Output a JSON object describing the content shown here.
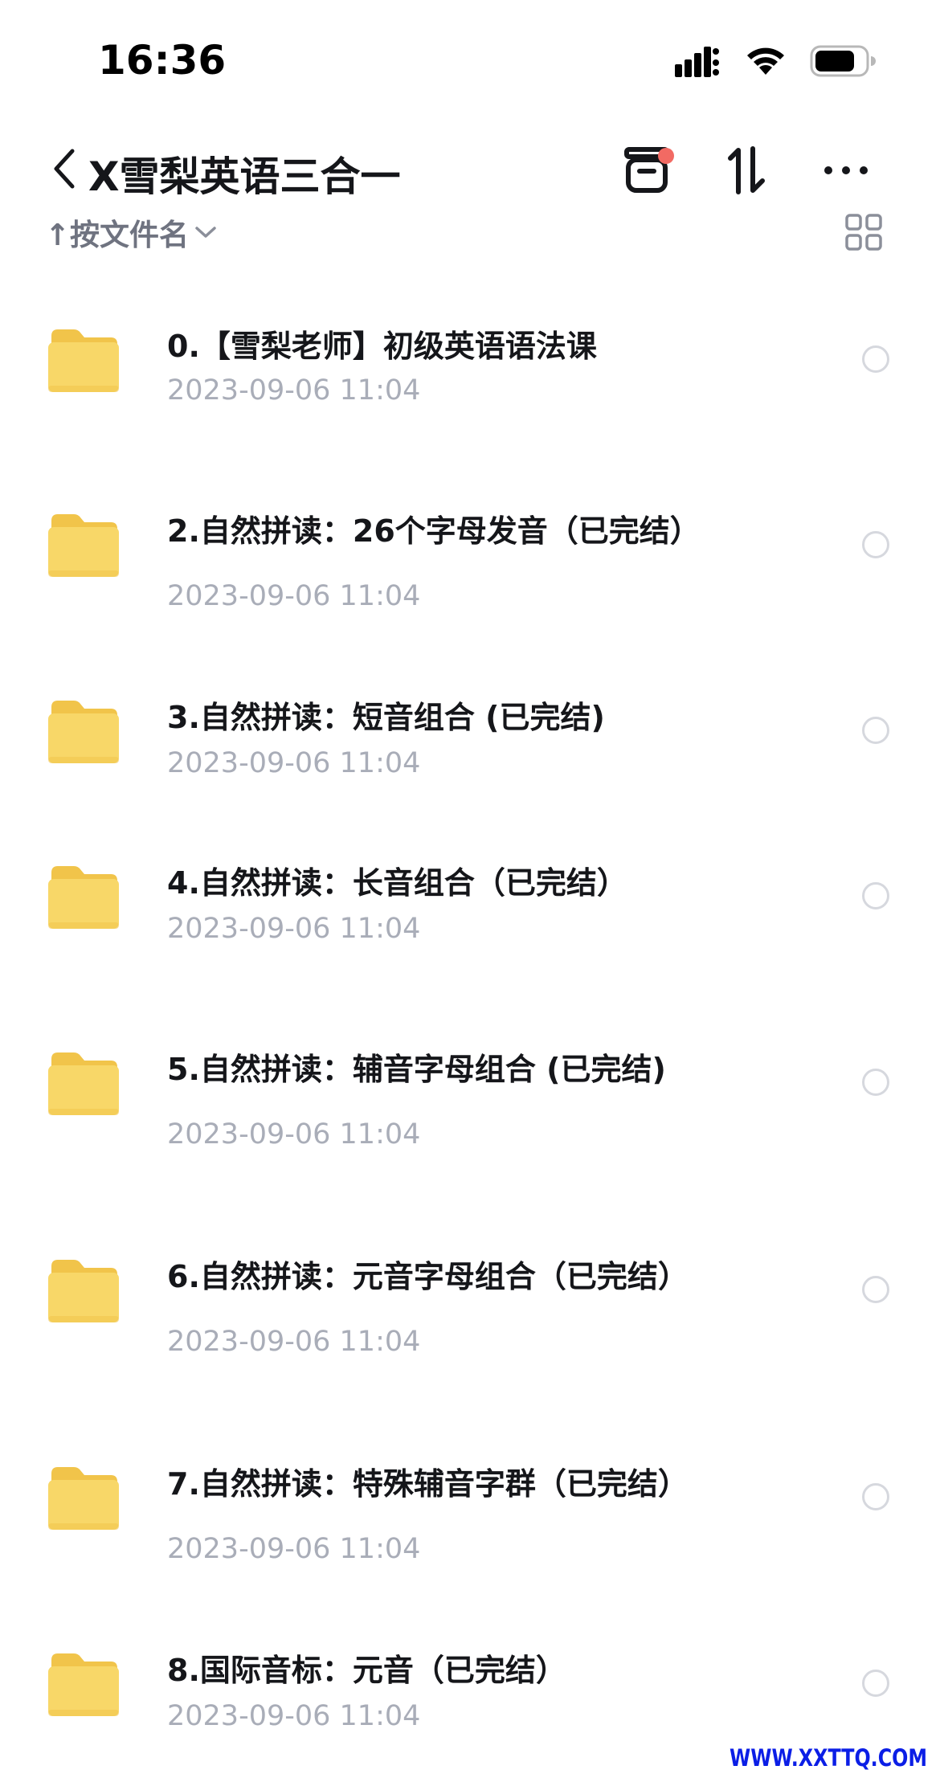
{
  "status_bar": {
    "time": "16:36"
  },
  "header": {
    "title": "X雪梨英语三合一",
    "icons": [
      "back-chevron-icon",
      "transfer-box-icon",
      "sort-order-icon",
      "more-icon"
    ]
  },
  "sort": {
    "label": "↑按文件名",
    "icons": [
      "chevron-down-icon",
      "grid-view-icon"
    ]
  },
  "colors": {
    "folder": "#f8d768",
    "folder_dark": "#f1c44a",
    "notify_dot": "#f26a63",
    "date_text": "#a9adb8",
    "watermark": "#0b1ee6"
  },
  "files": [
    {
      "name": "0.【雪梨老师】初级英语语法课",
      "date": "2023-09-06 11:04"
    },
    {
      "name": "2.自然拼读：26个字母发音（已完结）",
      "date": "2023-09-06 11:04"
    },
    {
      "name": "3.自然拼读：短音组合 (已完结)",
      "date": "2023-09-06 11:04"
    },
    {
      "name": "4.自然拼读：长音组合（已完结）",
      "date": "2023-09-06 11:04"
    },
    {
      "name": "5.自然拼读：辅音字母组合 (已完结)",
      "date": "2023-09-06 11:04"
    },
    {
      "name": "6.自然拼读：元音字母组合（已完结）",
      "date": "2023-09-06 11:04"
    },
    {
      "name": "7.自然拼读：特殊辅音字群（已完结）",
      "date": "2023-09-06 11:04"
    },
    {
      "name": "8.国际音标：元音（已完结）",
      "date": "2023-09-06 11:04"
    }
  ],
  "watermark": "WWW.XXTTQ.COM"
}
